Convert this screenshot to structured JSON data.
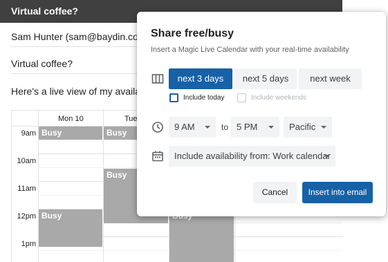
{
  "compose": {
    "subject_header": "Virtual coffee?",
    "to": "Sam Hunter (sam@baydin.co",
    "subject": "Virtual coffee?",
    "body_text": "Here's a live view of my availa"
  },
  "calendar": {
    "days": [
      "Mon 10",
      "Tue",
      ""
    ],
    "times": [
      "9am",
      "10am",
      "11am",
      "12pm",
      "1pm"
    ],
    "busy_label": "Busy"
  },
  "dialog": {
    "title": "Share free/busy",
    "subtitle": "Insert a Magic Live Calendar with your real-time availability",
    "range_options": [
      "next 3 days",
      "next 5 days",
      "next week"
    ],
    "selected_range": "next 3 days",
    "include_today_label": "Include today",
    "include_today_checked": false,
    "include_weekends_label": "Include weekends",
    "include_weekends_enabled": false,
    "start_time": "9 AM",
    "to_label": "to",
    "end_time": "5 PM",
    "timezone": "Pacific",
    "availability_from": "Include availability from: Work calendar",
    "cancel_label": "Cancel",
    "insert_label": "Insert into email"
  },
  "colors": {
    "accent": "#1761a6",
    "busy": "#a9a9a9",
    "header_bg": "#404040"
  },
  "icons": {
    "range": "view-columns-icon",
    "time": "clock-icon",
    "calendar": "calendar-icon"
  }
}
